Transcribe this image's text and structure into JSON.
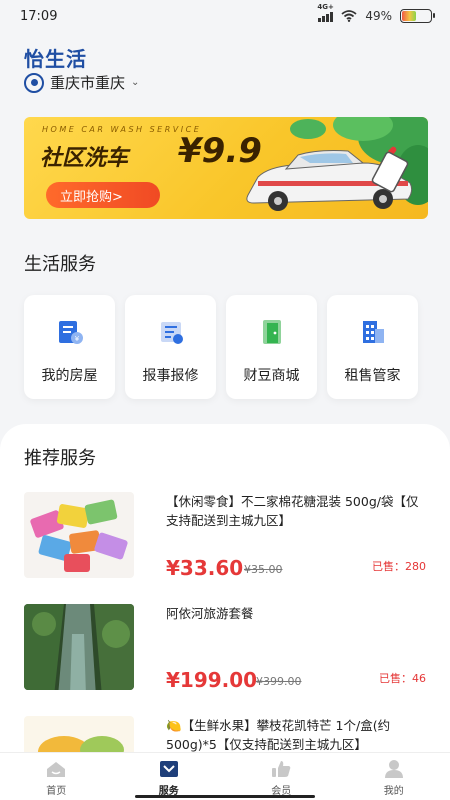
{
  "status_bar": {
    "time": "17:09",
    "network": "4G+",
    "battery": "49%",
    "battery_level": 0.49
  },
  "header": {
    "logo": "怡生活",
    "location": "重庆市重庆"
  },
  "banner": {
    "subtitle": "HOME CAR WASH SERVICE",
    "title": "社区洗车",
    "price": "¥9.9",
    "button": "立即抢购>",
    "colors": {
      "bg": "#f9c62a",
      "button": "#f04a24"
    }
  },
  "life_services": {
    "title": "生活服务",
    "items": [
      {
        "label": "我的房屋",
        "icon": "house-bill-icon"
      },
      {
        "label": "报事报修",
        "icon": "report-repair-icon"
      },
      {
        "label": "财豆商城",
        "icon": "shop-door-icon"
      },
      {
        "label": "租售管家",
        "icon": "building-icon"
      }
    ]
  },
  "recommend": {
    "title": "推荐服务",
    "items": [
      {
        "name": "【休闲零食】不二家棉花糖混装 500g/袋【仅支持配送到主城九区】",
        "price": "¥33.60",
        "old_price": "¥35.00",
        "sold": "已售：280"
      },
      {
        "name": "阿依河旅游套餐",
        "price": "¥199.00",
        "old_price": "¥399.00",
        "sold": "已售：46"
      },
      {
        "name": "🍋【生鲜水果】攀枝花凯特芒 1个/盒(约500g)*5【仅支持配送到主城九区】",
        "price": "",
        "old_price": "",
        "sold": ""
      }
    ]
  },
  "tabbar": {
    "tabs": [
      {
        "label": "首页",
        "icon": "home-icon"
      },
      {
        "label": "服务",
        "icon": "service-icon",
        "active": true
      },
      {
        "label": "会员",
        "icon": "thumbs-up-icon"
      },
      {
        "label": "我的",
        "icon": "profile-icon"
      }
    ]
  },
  "accent_colors": {
    "brand": "#1f4ea3",
    "price": "#e53838"
  }
}
